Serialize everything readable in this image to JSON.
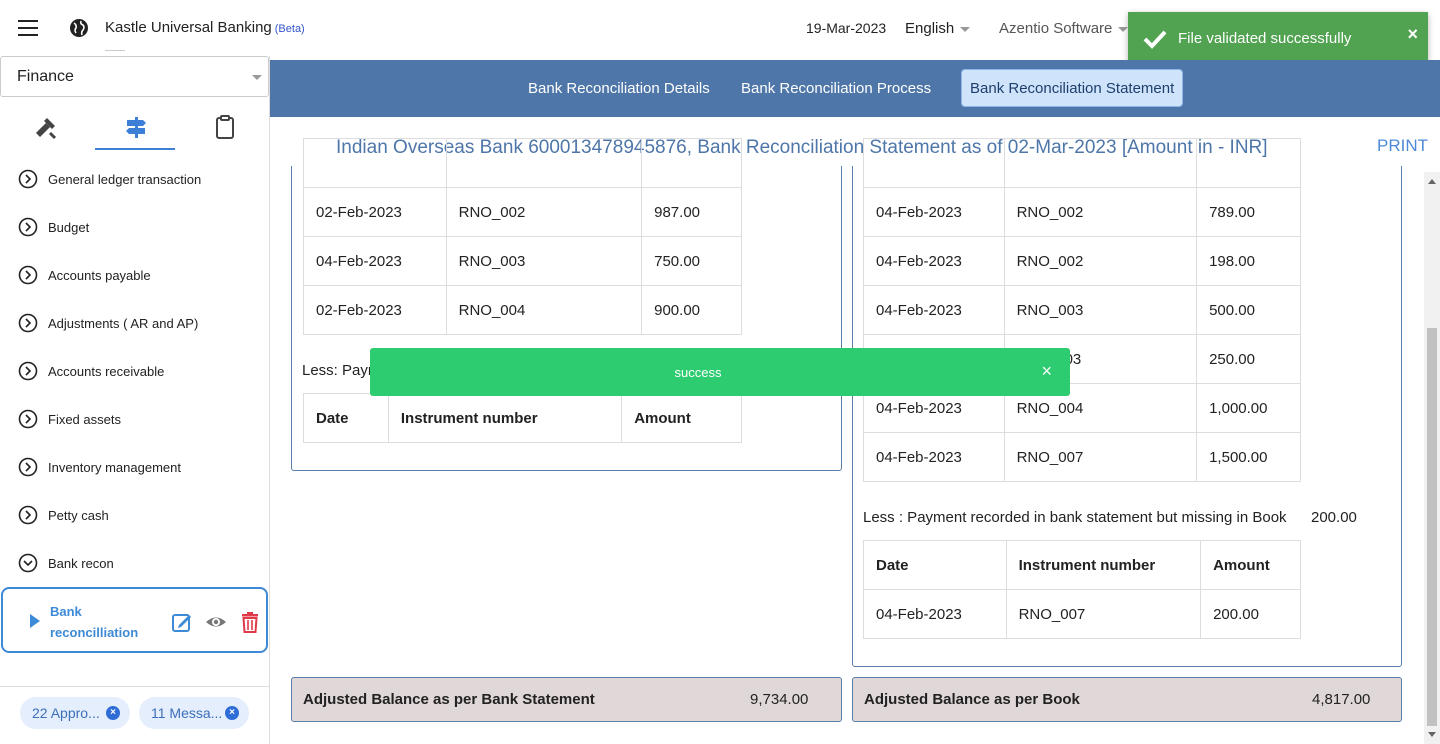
{
  "header": {
    "app_title": "Kastle Universal Banking",
    "beta": "(Beta)",
    "date": "19-Mar-2023",
    "language": "English",
    "org": "Azentio Software"
  },
  "toast": {
    "message": "File validated successfully",
    "close": "×"
  },
  "sidebar": {
    "module": "Finance",
    "items": [
      {
        "label": "General ledger transaction"
      },
      {
        "label": "Budget"
      },
      {
        "label": "Accounts payable"
      },
      {
        "label": "Adjustments ( AR and AP)"
      },
      {
        "label": "Accounts receivable"
      },
      {
        "label": "Fixed assets"
      },
      {
        "label": "Inventory management"
      },
      {
        "label": "Petty cash"
      },
      {
        "label": "Bank recon"
      }
    ],
    "active_sub": "Bank reconcilliation",
    "chips": [
      {
        "label": "22 Appro..."
      },
      {
        "label": "11 Messa..."
      }
    ]
  },
  "tabs": [
    {
      "label": "Bank Reconciliation Details"
    },
    {
      "label": "Bank Reconciliation Process"
    },
    {
      "label": "Bank Reconciliation Statement"
    }
  ],
  "statement": {
    "title": "Indian Overseas Bank 600013478945876, Bank Reconciliation Statement as of 02-Mar-2023 [Amount in - INR]",
    "print": "PRINT",
    "left": {
      "rows": [
        [
          "02-Feb-2023",
          "RNO_002",
          "987.00"
        ],
        [
          "04-Feb-2023",
          "RNO_003",
          "750.00"
        ],
        [
          "02-Feb-2023",
          "RNO_004",
          "900.00"
        ]
      ],
      "less_label": "Less: Paym",
      "headers": [
        "Date",
        "Instrument number",
        "Amount"
      ]
    },
    "right": {
      "rows": [
        [
          "04-Feb-2023",
          "RNO_002",
          "789.00"
        ],
        [
          "04-Feb-2023",
          "RNO_002",
          "198.00"
        ],
        [
          "04-Feb-2023",
          "RNO_003",
          "500.00"
        ],
        [
          "",
          "03",
          "250.00"
        ],
        [
          "04-Feb-2023",
          "RNO_004",
          "1,000.00"
        ],
        [
          "04-Feb-2023",
          "RNO_007",
          "1,500.00"
        ]
      ],
      "less_label": "Less : Payment recorded in bank statement but missing in Book",
      "less_value": "200.00",
      "headers": [
        "Date",
        "Instrument number",
        "Amount"
      ],
      "missing_rows": [
        [
          "04-Feb-2023",
          "RNO_007",
          "200.00"
        ]
      ]
    },
    "balance_bank": {
      "label": "Adjusted Balance as per Bank Statement",
      "value": "9,734.00"
    },
    "balance_book": {
      "label": "Adjusted Balance as per Book",
      "value": "4,817.00"
    }
  },
  "banner": {
    "message": "success",
    "close": "×"
  },
  "colors": {
    "header_blue": "#4e76a8",
    "toast_green": "#51a351",
    "banner_green": "#2ecc71",
    "accent": "#3d8ad6"
  }
}
